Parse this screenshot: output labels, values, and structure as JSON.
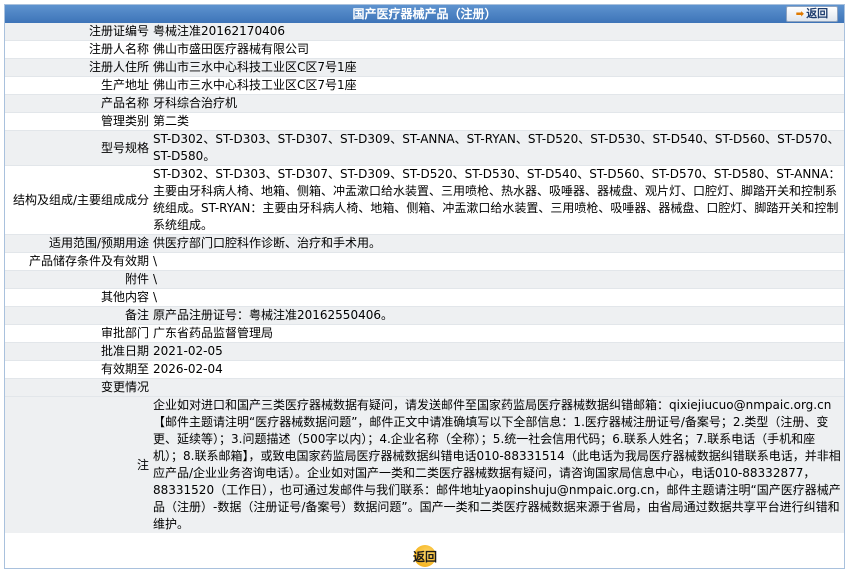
{
  "header": {
    "title": "国产医疗器械产品（注册）",
    "back_label": "返回"
  },
  "rows": [
    {
      "label": "注册证编号",
      "value": "粤械注准20162170406"
    },
    {
      "label": "注册人名称",
      "value": "佛山市盛田医疗器械有限公司"
    },
    {
      "label": "注册人住所",
      "value": "佛山市三水中心科技工业区C区7号1座"
    },
    {
      "label": "生产地址",
      "value": "佛山市三水中心科技工业区C区7号1座"
    },
    {
      "label": "产品名称",
      "value": "牙科综合治疗机"
    },
    {
      "label": "管理类别",
      "value": "第二类"
    },
    {
      "label": "型号规格",
      "value": "ST-D302、ST-D303、ST-D307、ST-D309、ST-ANNA、ST-RYAN、ST-D520、ST-D530、ST-D540、ST-D560、ST-D570、ST-D580。"
    },
    {
      "label": "结构及组成/主要组成成分",
      "value": "ST-D302、ST-D303、ST-D307、ST-D309、ST-D520、ST-D530、ST-D540、ST-D560、ST-D570、ST-D580、ST-ANNA：主要由牙科病人椅、地箱、侧箱、冲盂漱口给水装置、三用喷枪、热水器、吸唾器、器械盘、观片灯、口腔灯、脚踏开关和控制系统组成。ST-RYAN：主要由牙科病人椅、地箱、侧箱、冲盂漱口给水装置、三用喷枪、吸唾器、器械盘、口腔灯、脚踏开关和控制系统组成。"
    },
    {
      "label": "适用范围/预期用途",
      "value": "供医疗部门口腔科作诊断、治疗和手术用。"
    },
    {
      "label": "产品储存条件及有效期",
      "value": "\\"
    },
    {
      "label": "附件",
      "value": "\\"
    },
    {
      "label": "其他内容",
      "value": "\\"
    },
    {
      "label": "备注",
      "value": "原产品注册证号：粤械注准20162550406。"
    },
    {
      "label": "审批部门",
      "value": "广东省药品监督管理局"
    },
    {
      "label": "批准日期",
      "value": "2021-02-05"
    },
    {
      "label": "有效期至",
      "value": "2026-02-04"
    },
    {
      "label": "变更情况",
      "value": ""
    }
  ],
  "note": {
    "label": "注",
    "text": "企业如对进口和国产三类医疗器械数据有疑问，请发送邮件至国家药监局医疗器械数据纠错邮箱：qixiejiucuo@nmpaic.org.cn【邮件主题请注明“医疗器械数据问题”，邮件正文中请准确填写以下全部信息：1.医疗器械注册证号/备案号；2.类型（注册、变更、延续等）；3.问题描述（500字以内）；4.企业名称（全称）；5.统一社会信用代码；6.联系人姓名；7.联系电话（手机和座机）；8.联系邮箱】，或致电国家药监局医疗器械数据纠错电话010-88331514（此电话为我局医疗器械数据纠错联系电话，并非相应产品/企业业务咨询电话）。企业如对国产一类和二类医疗器械数据有疑问，请咨询国家局信息中心，电话010-88332877，88331520（工作日），也可通过发邮件与我们联系：邮件地址yaopinshuju@nmpaic.org.cn，邮件主题请注明“国产医疗器械产品（注册）-数据（注册证号/备案号）数据问题”。国产一类和二类医疗器械数据来源于省局，由省局通过数据共享平台进行纠错和维护。"
  },
  "footer": {
    "back_label": "返回"
  }
}
